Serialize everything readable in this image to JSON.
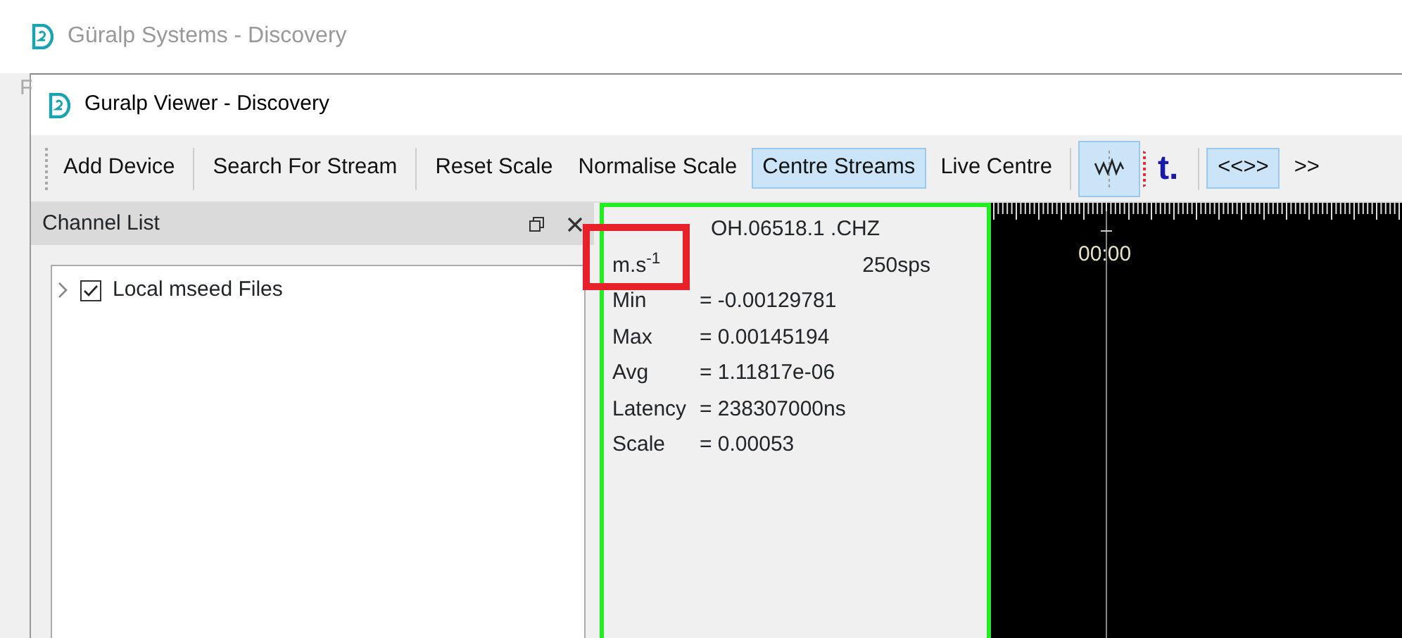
{
  "app_window": {
    "title": "Güralp Systems - Discovery",
    "menu_partial": "F"
  },
  "window": {
    "title": "Guralp Viewer - Discovery"
  },
  "toolbar": [
    {
      "kind": "text",
      "label": "Add Device",
      "selected": false
    },
    {
      "kind": "separator"
    },
    {
      "kind": "text",
      "label": "Search For Stream",
      "selected": false
    },
    {
      "kind": "separator"
    },
    {
      "kind": "text",
      "label": "Reset Scale",
      "selected": false
    },
    {
      "kind": "text",
      "label": "Normalise Scale",
      "selected": false
    },
    {
      "kind": "text",
      "label": "Centre Streams",
      "selected": true
    },
    {
      "kind": "text",
      "label": "Live Centre",
      "selected": false
    },
    {
      "kind": "separator"
    },
    {
      "kind": "wave",
      "selected": true
    },
    {
      "kind": "tlogo",
      "label": "t.",
      "selected": false
    },
    {
      "kind": "separator"
    },
    {
      "kind": "text",
      "label": "<<>>",
      "selected": true
    },
    {
      "kind": "text",
      "label": ">>",
      "selected": false
    }
  ],
  "channel_list": {
    "title": "Channel List",
    "items": [
      {
        "label": "Local mseed Files",
        "checked": true,
        "expanded": false
      }
    ]
  },
  "stream": {
    "name": "OH.06518.1 .CHZ",
    "units": "m.s$^{-1}$",
    "rate": "250sps",
    "stats": [
      {
        "label": "Min",
        "value": "= -0.00129781"
      },
      {
        "label": "Max",
        "value": "= 0.00145194"
      },
      {
        "label": "Avg",
        "value": "= 1.11817e-06"
      },
      {
        "label": "Latency",
        "value": "= 238307000ns"
      },
      {
        "label": "Scale",
        "value": "= 0.00053"
      }
    ]
  },
  "trace": {
    "time_label": "00:00"
  }
}
